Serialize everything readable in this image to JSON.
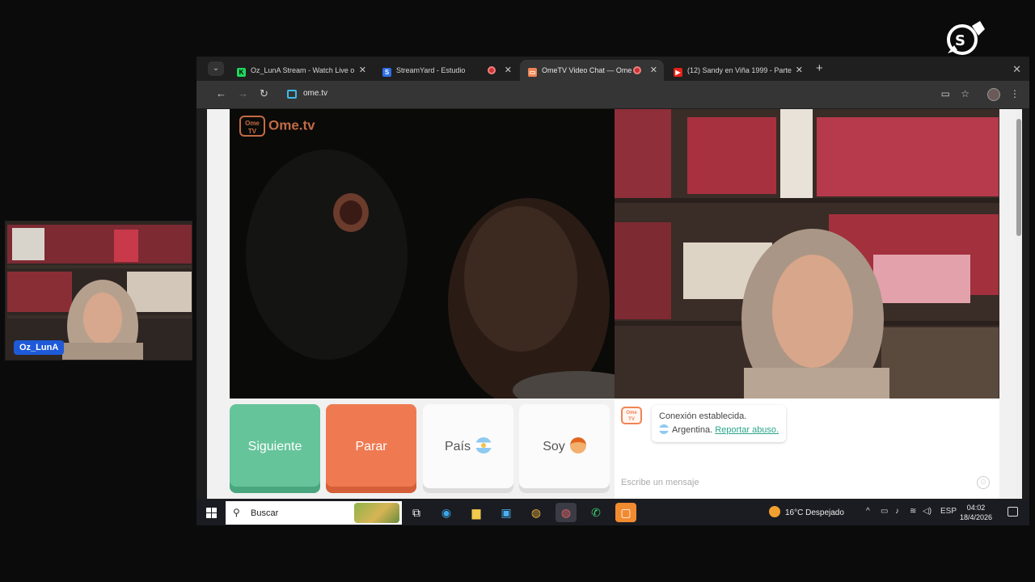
{
  "streamyard": {
    "brand": "streamyard"
  },
  "camera": {
    "name_tag": "Oz_LunA"
  },
  "browser": {
    "tabs": [
      {
        "label": "Oz_LunA Stream - Watch Live o",
        "favicon": "kick-icon",
        "favicon_color": "#1ed760",
        "active": false,
        "recording": false
      },
      {
        "label": "StreamYard - Estudio",
        "favicon": "streamyard-icon",
        "favicon_color": "#2f6fe4",
        "active": false,
        "recording": true
      },
      {
        "label": "OmeTV Video Chat — Ome",
        "favicon": "ometv-icon",
        "favicon_color": "#f08454",
        "active": true,
        "recording": true
      },
      {
        "label": "(12) Sandy en Viña 1999 - Parte",
        "favicon": "youtube-icon",
        "favicon_color": "#e62117",
        "active": false,
        "recording": false
      }
    ],
    "url": "ome.tv"
  },
  "ometv": {
    "logo_text": "Ome.tv",
    "logo_badge": "Ome TV",
    "buttons": {
      "next": "Siguiente",
      "stop": "Parar",
      "country": "País",
      "gender": "Soy"
    },
    "chat": {
      "status": "Conexión establecida.",
      "country": "Argentina.",
      "report_link": "Reportar abuso.",
      "input_placeholder": "Escribe un mensaje"
    }
  },
  "taskbar": {
    "search_label": "Buscar",
    "weather": "16°C Despejado",
    "language": "ESP",
    "time": "04:02",
    "date": "18/4/2026"
  },
  "colors": {
    "next_button": "#66c49b",
    "stop_button": "#ef7a52",
    "brand_orange": "#f08454",
    "link": "#2aa58a"
  }
}
